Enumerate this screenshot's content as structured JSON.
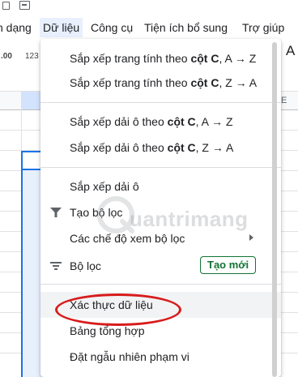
{
  "menubar": {
    "items": [
      {
        "label": "h dạng",
        "active": false
      },
      {
        "label": "Dữ liệu",
        "active": true
      },
      {
        "label": "Công cụ",
        "active": false
      },
      {
        "label": "Tiện ích bổ sung",
        "active": false
      },
      {
        "label": "Trợ giúp",
        "active": false
      }
    ]
  },
  "toolbar": {
    "format_1": ".00",
    "format_2": "123",
    "font_button": "A"
  },
  "grid": {
    "header_right_letter": "E"
  },
  "dropdown": {
    "sort_sheet_az": {
      "prefix": "Sắp xếp trang tính theo ",
      "bold": "cột C",
      "suffix": ", A → Z"
    },
    "sort_sheet_za": {
      "prefix": "Sắp xếp trang tính theo ",
      "bold": "cột C",
      "suffix": ", Z → A"
    },
    "sort_range_az": {
      "prefix": "Sắp xếp dải ô theo ",
      "bold": "cột C",
      "suffix": ", A → Z"
    },
    "sort_range_za": {
      "prefix": "Sắp xếp dải ô theo ",
      "bold": "cột C",
      "suffix": ", Z → A"
    },
    "sort_range": "Sắp xếp dải ô",
    "create_filter": "Tạo bộ lọc",
    "filter_views": "Các chế độ xem bộ lọc",
    "slicer": "Bộ lọc",
    "new_badge": "Tạo mới",
    "data_validation": "Xác thực dữ liệu",
    "pivot_table": "Bảng tổng hợp",
    "randomize_range": "Đặt ngẫu nhiên phạm vi"
  },
  "watermark": {
    "text": "uantrimang"
  },
  "colors": {
    "accent_green": "#137333",
    "highlight_red": "#d81b1b",
    "selection_blue": "#1a73e8",
    "menu_active_bg": "#e8f0fe"
  }
}
